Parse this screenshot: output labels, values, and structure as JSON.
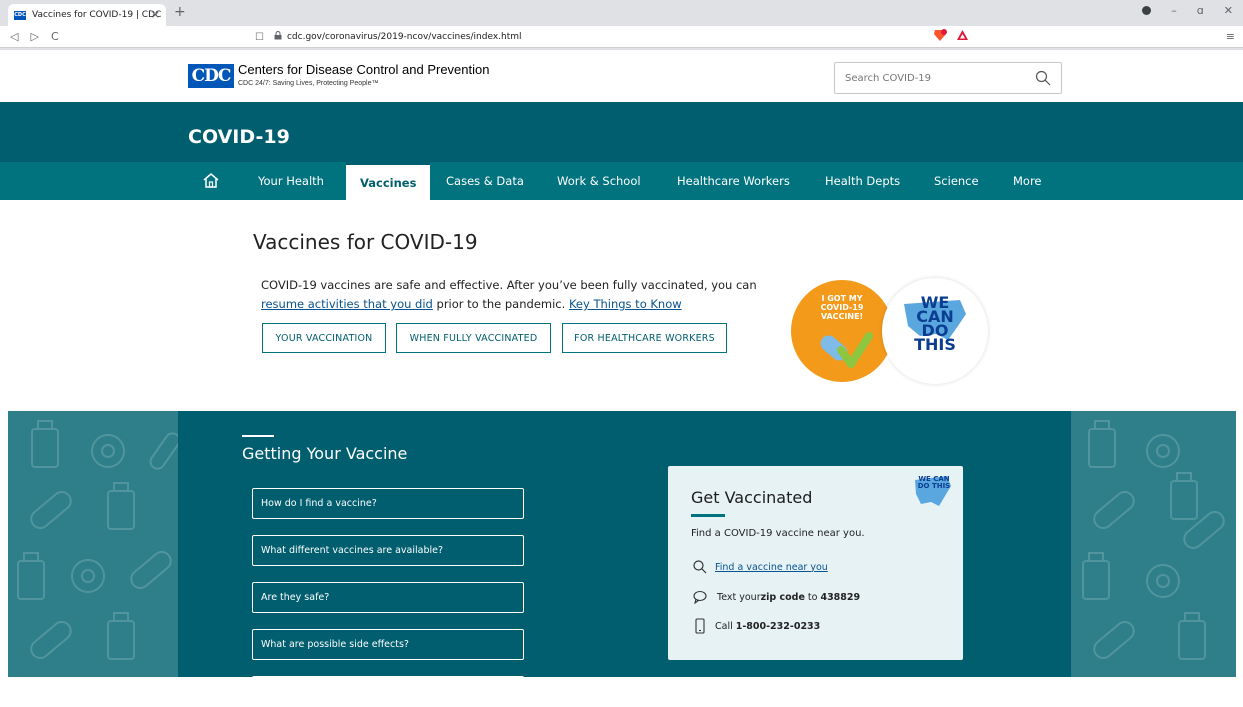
{
  "browser": {
    "tab_title": "Vaccines for COVID-19 | CDC",
    "favicon_text": "CDC",
    "url": "cdc.gov/coronavirus/2019-ncov/vaccines/index.html",
    "close_glyph": "×",
    "new_tab_glyph": "+",
    "back_glyph": "◁",
    "forward_glyph": "▷",
    "reload_glyph": "C",
    "bookmark_glyph": "☐",
    "lock_glyph": "🔒",
    "menu_glyph": "≡",
    "minimize_glyph": "–",
    "restore_glyph": "ɑ",
    "window_close_glyph": "✕"
  },
  "header": {
    "logo_text": "CDC",
    "org_name": "Centers for Disease Control and Prevention",
    "tagline": "CDC 24/7: Saving Lives, Protecting People™",
    "search_placeholder": "Search COVID-19"
  },
  "banner": {
    "title": "COVID-19"
  },
  "nav": {
    "items": [
      "Your Health",
      "Vaccines",
      "Cases & Data",
      "Work & School",
      "Healthcare Workers",
      "Health Depts",
      "Science",
      "More"
    ],
    "active": "Vaccines"
  },
  "hero": {
    "title": "Vaccines for COVID-19",
    "text_1": "COVID-19 vaccines are safe and effective. After you’ve been fully vaccinated, you can",
    "link_1": "resume activities that you did",
    "text_2": " prior to the pandemic. ",
    "link_2": "Key Things to Know",
    "buttons": [
      "YOUR VACCINATION",
      "WHEN FULLY VACCINATED",
      "FOR HEALTHCARE WORKERS"
    ],
    "badge_orange_text": "I GOT MY COVID-19 VACCINE!",
    "badge_blue_text": "WE CAN DO THIS"
  },
  "getting": {
    "title": "Getting Your Vaccine",
    "questions": [
      "How do I find a vaccine?",
      "What different vaccines are available?",
      "Are they safe?",
      "What are possible side effects?"
    ]
  },
  "card": {
    "title": "Get Vaccinated",
    "subtitle": "Find a COVID-19 vaccine near you.",
    "find_link": "Find a vaccine near you",
    "text_pre": "Text your ",
    "text_bold": "zip code",
    "text_mid": " to ",
    "text_number": "438829",
    "call_pre": "Call ",
    "call_number": "1-800-232-0233",
    "badge_text": "WE CAN DO THIS"
  },
  "colors": {
    "teal_dark": "#005e6e",
    "teal_nav": "#00737f",
    "cdc_blue": "#0057b7",
    "link_blue": "#075290",
    "badge_orange": "#f39a1b"
  }
}
